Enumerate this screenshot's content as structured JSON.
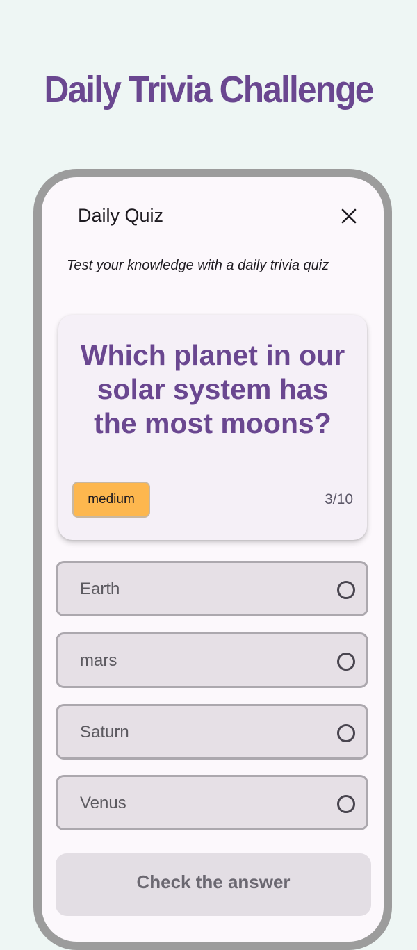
{
  "page": {
    "headline": "Daily Trivia Challenge"
  },
  "app": {
    "title": "Daily Quiz",
    "close_icon": "close-icon",
    "subtitle": "Test your knowledge with a daily trivia quiz"
  },
  "question": {
    "text": "Which planet in our solar system has the most moons?",
    "difficulty": "medium",
    "progress": "3/10"
  },
  "options": [
    {
      "label": "Earth",
      "selected": false
    },
    {
      "label": "mars",
      "selected": false
    },
    {
      "label": "Saturn",
      "selected": false
    },
    {
      "label": "Venus",
      "selected": false
    }
  ],
  "actions": {
    "check_label": "Check the answer"
  },
  "colors": {
    "background": "#eef6f4",
    "accent": "#6a4790",
    "difficulty_badge": "#fdb74e",
    "card": "#f5f0f7",
    "option_fill": "#e6e0e6",
    "phone_frame": "#9c9c9c"
  }
}
